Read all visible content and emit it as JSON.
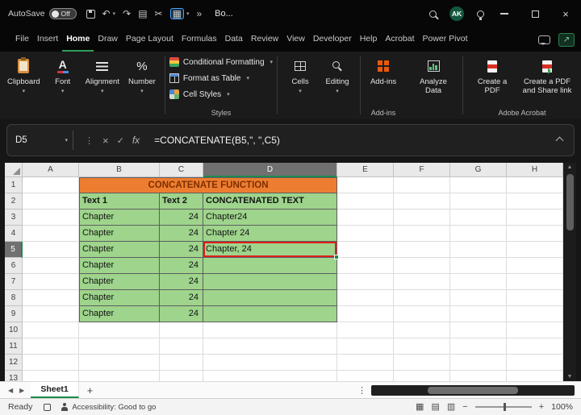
{
  "titlebar": {
    "autosave_label": "AutoSave",
    "autosave_state": "Off",
    "workbook_name": "Bo...",
    "avatar": "AK"
  },
  "menubar": {
    "items": [
      "File",
      "Insert",
      "Home",
      "Draw",
      "Page Layout",
      "Formulas",
      "Data",
      "Review",
      "View",
      "Developer",
      "Help",
      "Acrobat",
      "Power Pivot"
    ]
  },
  "ribbon": {
    "clipboard": "Clipboard",
    "font": "Font",
    "alignment": "Alignment",
    "number": "Number",
    "conditional_formatting": "Conditional Formatting",
    "format_as_table": "Format as Table",
    "cell_styles": "Cell Styles",
    "styles_group": "Styles",
    "cells": "Cells",
    "editing": "Editing",
    "addins_button": "Add-ins",
    "addins_group": "Add-ins",
    "analyze_data": "Analyze Data",
    "create_pdf": "Create a PDF",
    "create_pdf_share": "Create a PDF and Share link",
    "acrobat_group": "Adobe Acrobat"
  },
  "formula_bar": {
    "name_box": "D5",
    "formula": "=CONCATENATE(B5,\", \",C5)"
  },
  "sheet": {
    "col_headers": [
      "A",
      "B",
      "C",
      "D",
      "E",
      "F",
      "G",
      "H"
    ],
    "row_headers": [
      "1",
      "2",
      "3",
      "4",
      "5",
      "6",
      "7",
      "8",
      "9",
      "10",
      "11",
      "12",
      "13"
    ],
    "title": "CONCATENATE FUNCTION",
    "table_headers": {
      "b": "Text 1",
      "c": "Text 2",
      "d": "CONCATENATED TEXT"
    },
    "rows": [
      {
        "b": "Chapter",
        "c": "24",
        "d": "Chapter24"
      },
      {
        "b": "Chapter",
        "c": "24",
        "d": "Chapter 24"
      },
      {
        "b": "Chapter",
        "c": "24",
        "d": "Chapter, 24"
      },
      {
        "b": "Chapter",
        "c": "24",
        "d": ""
      },
      {
        "b": "Chapter",
        "c": "24",
        "d": ""
      },
      {
        "b": "Chapter",
        "c": "24",
        "d": ""
      },
      {
        "b": "Chapter",
        "c": "24",
        "d": ""
      }
    ],
    "selected_cell": "D5"
  },
  "tabs": {
    "sheet1": "Sheet1"
  },
  "statusbar": {
    "ready": "Ready",
    "accessibility": "Accessibility: Good to go",
    "zoom": "100%"
  },
  "icons": {
    "undo": "↶",
    "redo": "↷",
    "copy": "▤",
    "cut": "✂",
    "paste": "▦",
    "chevron_down": "▾",
    "overflow": "»",
    "more_dots": "⋮",
    "cancel": "×",
    "enter": "✓",
    "fx": "fx",
    "tab_prev": "◀",
    "tab_next": "▶",
    "scroll_up": "▲",
    "scroll_down": "▼",
    "add_sheet": "+",
    "view_normal": "▦",
    "view_layout": "▤",
    "view_break": "▥",
    "zoom_out": "−",
    "zoom_in": "+",
    "share_arrow": "↗",
    "close": "×"
  },
  "colors": {
    "title_fill": "#ED7D31",
    "title_text": "#7E2F00",
    "table_fill": "#9ED48C",
    "highlight_red": "#E01E1E",
    "accent_green": "#1E8A4C"
  }
}
